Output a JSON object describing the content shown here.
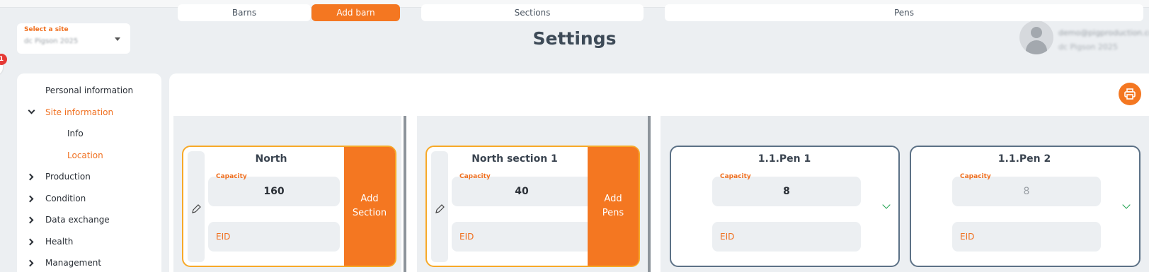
{
  "site_select": {
    "label": "Select a site",
    "value": "dc Pigson 2025"
  },
  "notifications": {
    "count": "1"
  },
  "page_title": "Settings",
  "user": {
    "email": "demo@pigproduction.com",
    "site": "dc Pigson 2025"
  },
  "sidebar": {
    "items": [
      {
        "label": "Personal information"
      },
      {
        "label": "Site information"
      },
      {
        "label": "Info"
      },
      {
        "label": "Location"
      },
      {
        "label": "Production"
      },
      {
        "label": "Condition"
      },
      {
        "label": "Data exchange"
      },
      {
        "label": "Health"
      },
      {
        "label": "Management"
      }
    ]
  },
  "columns": {
    "barns": {
      "header": "Barns",
      "add_label": "Add barn"
    },
    "sections": {
      "header": "Sections"
    },
    "pens": {
      "header": "Pens"
    }
  },
  "cards": {
    "barn": {
      "title": "North",
      "capacity_label": "Capacity",
      "capacity": "160",
      "eid_label": "EID",
      "add_line1": "Add",
      "add_line2": "Section"
    },
    "section": {
      "title": "North section 1",
      "capacity_label": "Capacity",
      "capacity": "40",
      "eid_label": "EID",
      "add_line1": "Add",
      "add_line2": "Pens"
    },
    "pen1": {
      "title": "1.1.Pen 1",
      "capacity_label": "Capacity",
      "capacity": "8",
      "eid_label": "EID"
    },
    "pen2": {
      "title": "1.1.Pen 2",
      "capacity_label": "Capacity",
      "capacity": "8",
      "eid_label": "EID"
    }
  },
  "colors": {
    "accent": "#f47721",
    "barn_border": "#f7a928",
    "pen_border": "#5c7186",
    "background": "#eceff2"
  }
}
